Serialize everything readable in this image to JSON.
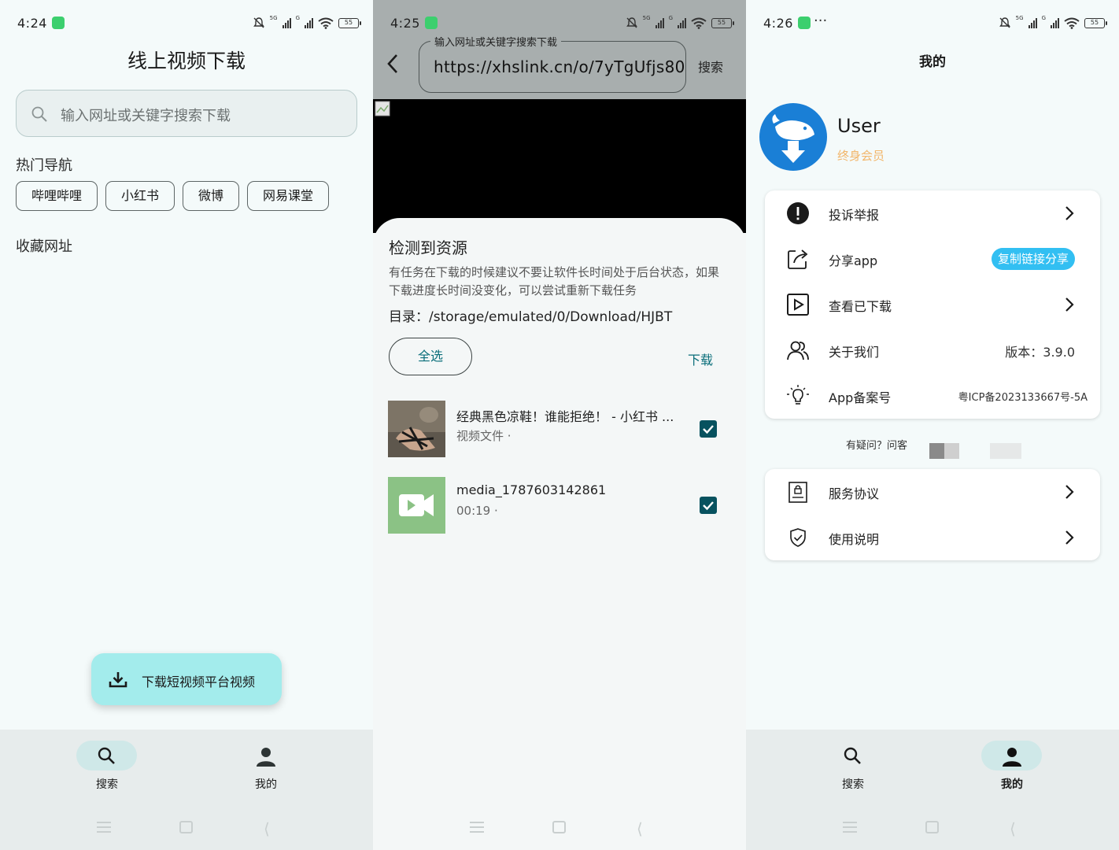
{
  "panel1": {
    "status": {
      "time": "4:24",
      "network1": "5G",
      "network2": "G",
      "battery": "55"
    },
    "title": "线上视频下载",
    "search": {
      "placeholder": "输入网址或关键字搜索下载"
    },
    "hot_nav_label": "热门导航",
    "hot_nav": [
      "哔哩哔哩",
      "小红书",
      "微博",
      "网易课堂"
    ],
    "favorites_label": "收藏网址",
    "fab_label": "下载短视频平台视频",
    "nav": {
      "search": "搜索",
      "mine": "我的",
      "active": "search"
    }
  },
  "panel2": {
    "status": {
      "time": "4:25",
      "network1": "5G",
      "network2": "G",
      "battery": "55"
    },
    "field_label": "输入网址或关键字搜索下载",
    "url": "https://xhslink.cn/o/7yTgUfjs80",
    "search_button": "搜索",
    "sheet": {
      "title": "检测到资源",
      "desc": "有任务在下载的时候建议不要让软件长时间处于后台状态，如果下载进度长时间没变化，可以尝试重新下载任务",
      "dir_label": "目录：",
      "dir_path": "/storage/emulated/0/Download/HJBT",
      "select_all": "全选",
      "download": "下载",
      "resources": [
        {
          "name": "经典黑色凉鞋！谁能拒绝！ - 小红书 ...",
          "sub": "视频文件 ·",
          "checked": true
        },
        {
          "name": "media_1787603142861",
          "sub": "00:19 ·",
          "checked": true
        }
      ]
    }
  },
  "panel3": {
    "status": {
      "time": "4:26",
      "extra": "···",
      "network1": "5G",
      "network2": "G",
      "battery": "55"
    },
    "title": "我的",
    "user": {
      "name": "User",
      "badge": "终身会员"
    },
    "menu1": [
      {
        "label": "投诉举报",
        "icon": "alert-icon"
      },
      {
        "label": "分享app",
        "icon": "share-icon",
        "pill": "复制链接分享"
      },
      {
        "label": "查看已下载",
        "icon": "play-square-icon"
      },
      {
        "label": "关于我们",
        "icon": "users-icon",
        "value": "版本：3.9.0"
      },
      {
        "label": "App备案号",
        "icon": "bulb-icon",
        "value": "粤ICP备2023133667号-5A"
      }
    ],
    "faq": "有疑问？问客",
    "menu2": [
      {
        "label": "服务协议",
        "icon": "document-lock-icon"
      },
      {
        "label": "使用说明",
        "icon": "shield-check-icon"
      }
    ],
    "nav": {
      "search": "搜索",
      "mine": "我的",
      "active": "mine"
    }
  },
  "colors": {
    "accent": "#0a6e7a",
    "chip_border": "#5d6565",
    "fab": "#a3ecec",
    "nav_pill": "#cfe8e8",
    "badge": "#f2b66b",
    "share_pill": "#32bff2",
    "avatar": "#1a7fd6"
  }
}
